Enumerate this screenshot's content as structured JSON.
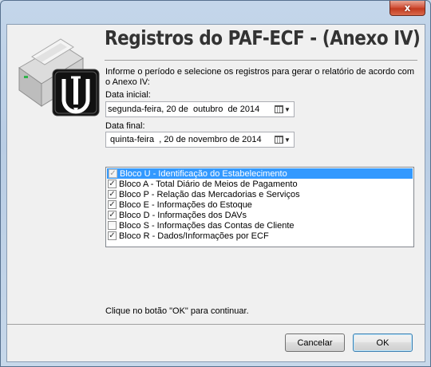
{
  "window": {
    "close_glyph": "x"
  },
  "header": {
    "title": "Registros do PAF-ECF - (Anexo IV)"
  },
  "form": {
    "instructions": "Informe o período e selecione os registros para gerar o relatório de acordo com o Anexo IV:",
    "start_label": "Data inicial:",
    "start_value": "segunda-feira, 20 de  outubro  de 2014",
    "end_label": "Data final:",
    "end_value": " quinta-feira  , 20 de novembro de 2014",
    "footer_hint": "Clique no botão \"OK\" para continuar."
  },
  "blocks": [
    {
      "label": "Bloco U - Identificação do Estabelecimento",
      "checked": true,
      "selected": true,
      "disabled": true
    },
    {
      "label": "Bloco A - Total Diário de Meios de Pagamento",
      "checked": true,
      "selected": false,
      "disabled": false
    },
    {
      "label": "Bloco P - Relação das Mercadorias e Serviços",
      "checked": true,
      "selected": false,
      "disabled": false
    },
    {
      "label": "Bloco E - Informações do Estoque",
      "checked": true,
      "selected": false,
      "disabled": false
    },
    {
      "label": "Bloco D - Informações dos DAVs",
      "checked": true,
      "selected": false,
      "disabled": false
    },
    {
      "label": "Bloco S - Informações das Contas de Cliente",
      "checked": false,
      "selected": false,
      "disabled": false
    },
    {
      "label": "Bloco R - Dados/Informações por ECF",
      "checked": true,
      "selected": false,
      "disabled": false
    }
  ],
  "buttons": {
    "cancel": "Cancelar",
    "ok": "OK"
  },
  "icons": {
    "logo": "printer-logo-icon",
    "calendar": "calendar-icon",
    "dropdown": "chevron-down-icon",
    "close": "close-icon"
  },
  "colors": {
    "selection": "#3399ff",
    "client_bg": "#f0f0f0",
    "close_button": "#c23a20"
  }
}
